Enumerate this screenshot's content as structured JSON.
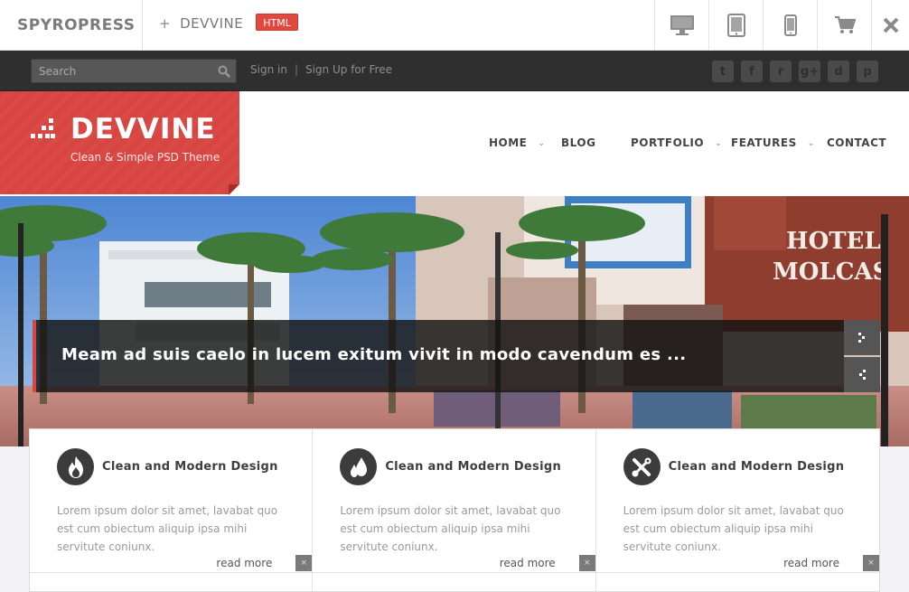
{
  "topbar": {
    "brand": "SPYROPRESS",
    "plus": "+",
    "product": "DEVVINE",
    "badge": "HTML",
    "devices": [
      "desktop-icon",
      "tablet-icon",
      "phone-icon",
      "cart-icon",
      "close-icon"
    ]
  },
  "utility": {
    "search_placeholder": "Search",
    "sign_in": "Sign in",
    "separator": "|",
    "sign_up": "Sign Up for Free",
    "socials": [
      {
        "name": "twitter-icon",
        "glyph": "t"
      },
      {
        "name": "facebook-icon",
        "glyph": "f"
      },
      {
        "name": "rss-icon",
        "glyph": "r"
      },
      {
        "name": "google-plus-icon",
        "glyph": "g+"
      },
      {
        "name": "dribbble-icon",
        "glyph": "d"
      },
      {
        "name": "pinterest-icon",
        "glyph": "p"
      }
    ]
  },
  "header": {
    "logo_title": "DEVVINE",
    "logo_subtitle": "Clean & Simple PSD Theme",
    "nav": {
      "home": "HOME",
      "blog": "BLOG",
      "portfolio": "PORTFOLIO",
      "features": "FEATURES",
      "contact": "CONTACT"
    }
  },
  "slider": {
    "caption": "Meam ad suis caelo in lucem exitum vivit in modo cavendum es ...",
    "sign_text": "HOTEL MOLCAS"
  },
  "features": [
    {
      "icon": "fire-icon",
      "title": "Clean and Modern Design",
      "text": "Lorem ipsum dolor sit amet, lavabat quo est cum obiectum aliquip ipsa mihi servitute coniunx.",
      "read_more": "read more"
    },
    {
      "icon": "drops-icon",
      "title": "Clean and Modern Design",
      "text": "Lorem ipsum dolor sit amet, lavabat quo est cum obiectum aliquip ipsa mihi servitute coniunx.",
      "read_more": "read more"
    },
    {
      "icon": "tools-icon",
      "title": "Clean and Modern Design",
      "text": "Lorem ipsum dolor sit amet, lavabat quo est cum obiectum aliquip ipsa mihi servitute coniunx.",
      "read_more": "read more"
    }
  ],
  "colors": {
    "accent": "#d84641",
    "dark_bar": "#2f2f2f",
    "icon_circle": "#3c3c3c"
  }
}
